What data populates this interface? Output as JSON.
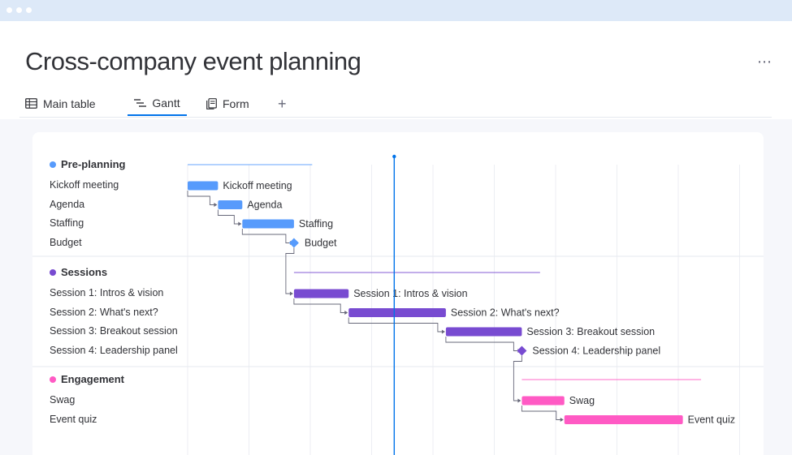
{
  "page": {
    "title": "Cross-company event planning"
  },
  "tabs": [
    {
      "label": "Main table",
      "icon": "table-icon",
      "active": false
    },
    {
      "label": "Gantt",
      "icon": "gantt-icon",
      "active": true
    },
    {
      "label": "Form",
      "icon": "form-icon",
      "active": false
    }
  ],
  "tab_add": "+",
  "menu": {
    "more": "⋯"
  },
  "groups": [
    {
      "name": "Pre-planning",
      "color": "#579bfc",
      "items": [
        {
          "label": "Kickoff meeting",
          "start": 0,
          "end": 1,
          "type": "bar"
        },
        {
          "label": "Agenda",
          "start": 1,
          "end": 1.8,
          "type": "bar"
        },
        {
          "label": "Staffing",
          "start": 1.8,
          "end": 3.5,
          "type": "bar"
        },
        {
          "label": "Budget",
          "start": 3.5,
          "end": 3.5,
          "type": "milestone"
        }
      ]
    },
    {
      "name": "Sessions",
      "color": "#784bd1",
      "items": [
        {
          "label": "Session 1: Intros & vision",
          "start": 3.5,
          "end": 5.3,
          "type": "bar"
        },
        {
          "label": "Session 2: What's next?",
          "start": 5.3,
          "end": 8.5,
          "type": "bar"
        },
        {
          "label": "Session 3: Breakout session",
          "start": 8.5,
          "end": 11,
          "type": "bar"
        },
        {
          "label": "Session 4: Leadership panel",
          "start": 11,
          "end": 11,
          "type": "milestone"
        }
      ]
    },
    {
      "name": "Engagement",
      "color": "#ff5ac4",
      "items": [
        {
          "label": "Swag",
          "start": 11,
          "end": 12.4,
          "type": "bar"
        },
        {
          "label": "Event quiz",
          "start": 12.4,
          "end": 16.3,
          "type": "bar"
        }
      ]
    }
  ],
  "timeline": {
    "today": 6.8
  }
}
